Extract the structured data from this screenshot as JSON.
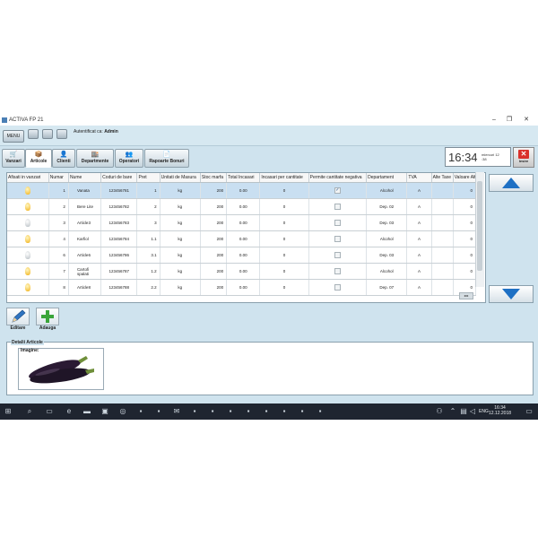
{
  "window": {
    "title": "ACTIVA FP 21",
    "controls": {
      "minimize": "–",
      "maximize": "❐",
      "close": "✕"
    }
  },
  "topbar": {
    "menu_label": "MENU",
    "auth_prefix": "Autentificat ca:",
    "auth_user": "Admin"
  },
  "nav": {
    "tabs": [
      {
        "label": "Vanzari",
        "icon": "cart-icon"
      },
      {
        "label": "Articole",
        "icon": "box-icon",
        "active": true
      },
      {
        "label": "Clienti",
        "icon": "person-icon"
      },
      {
        "label": "Departmente",
        "icon": "department-icon"
      },
      {
        "label": "Operatori",
        "icon": "operators-icon"
      },
      {
        "label": "Rapoarte Bonuri",
        "icon": "report-icon"
      }
    ]
  },
  "clock": {
    "time": "16:34",
    "date_line1": "miercuri 12",
    ".date_line2": ":38",
    "date_line2": ":38"
  },
  "exit_label": "Iesire",
  "table": {
    "columns": [
      "Afisati in vanzari",
      "Numar",
      "Nume",
      "Coduri de bare",
      "Pret",
      "Unitati de Masura",
      "Stoc marfa",
      "Total Incasari",
      "Incasari per cantitate",
      "Permite cantitate negativa",
      "Departament",
      "TVA",
      "Alte Taxe",
      "Valoare Alte"
    ],
    "rows": [
      {
        "bulb": "on",
        "numar": "1",
        "nume": "Vanata",
        "cod": "123456781",
        "pret": "1",
        "um": "kg",
        "stoc": "200",
        "total": "0.00",
        "per_cant": "0",
        "neg": true,
        "dep": "Alcohol",
        "tva": "A",
        "alte": "",
        "val": "0",
        "selected": true
      },
      {
        "bulb": "on",
        "numar": "2",
        "nume": "Bere Lite",
        "cod": "123456782",
        "pret": "2",
        "um": "kg",
        "stoc": "200",
        "total": "0.00",
        "per_cant": "0",
        "neg": false,
        "dep": "Dep. 02",
        "tva": "A",
        "alte": "",
        "val": "0"
      },
      {
        "bulb": "off",
        "numar": "3",
        "nume": "Article3",
        "cod": "123456783",
        "pret": "3",
        "um": "kg",
        "stoc": "200",
        "total": "0.00",
        "per_cant": "0",
        "neg": false,
        "dep": "Dep. 03",
        "tva": "A",
        "alte": "",
        "val": "0"
      },
      {
        "bulb": "on",
        "numar": "4",
        "nume": "Karfiol",
        "cod": "123456784",
        "pret": "1.1",
        "um": "kg",
        "stoc": "200",
        "total": "0.00",
        "per_cant": "0",
        "neg": false,
        "dep": "Alcohol",
        "tva": "A",
        "alte": "",
        "val": "0"
      },
      {
        "bulb": "off",
        "numar": "6",
        "nume": "Article6",
        "cod": "123456786",
        "pret": "3.1",
        "um": "kg",
        "stoc": "200",
        "total": "0.00",
        "per_cant": "0",
        "neg": false,
        "dep": "Dep. 03",
        "tva": "A",
        "alte": "",
        "val": "0"
      },
      {
        "bulb": "on",
        "numar": "7",
        "nume": "Cartofi spalati",
        "cod": "123456787",
        "pret": "1.2",
        "um": "kg",
        "stoc": "200",
        "total": "0.00",
        "per_cant": "0",
        "neg": false,
        "dep": "Alcohol",
        "tva": "A",
        "alte": "",
        "val": "0"
      },
      {
        "bulb": "on",
        "numar": "8",
        "nume": "Article8",
        "cod": "123456788",
        "pret": "2.2",
        "um": "kg",
        "stoc": "200",
        "total": "0.00",
        "per_cant": "0",
        "neg": false,
        "dep": "Dep. 07",
        "tva": "A",
        "alte": "",
        "val": "0"
      }
    ]
  },
  "actions": {
    "edit_label": "Editare",
    "add_label": "Adauga"
  },
  "details": {
    "legend": "Detalii Articole",
    "image_legend": "Imagine:"
  },
  "taskbar": {
    "time": "16:34",
    "date": "12.12.2018",
    "lang": "ENG"
  }
}
